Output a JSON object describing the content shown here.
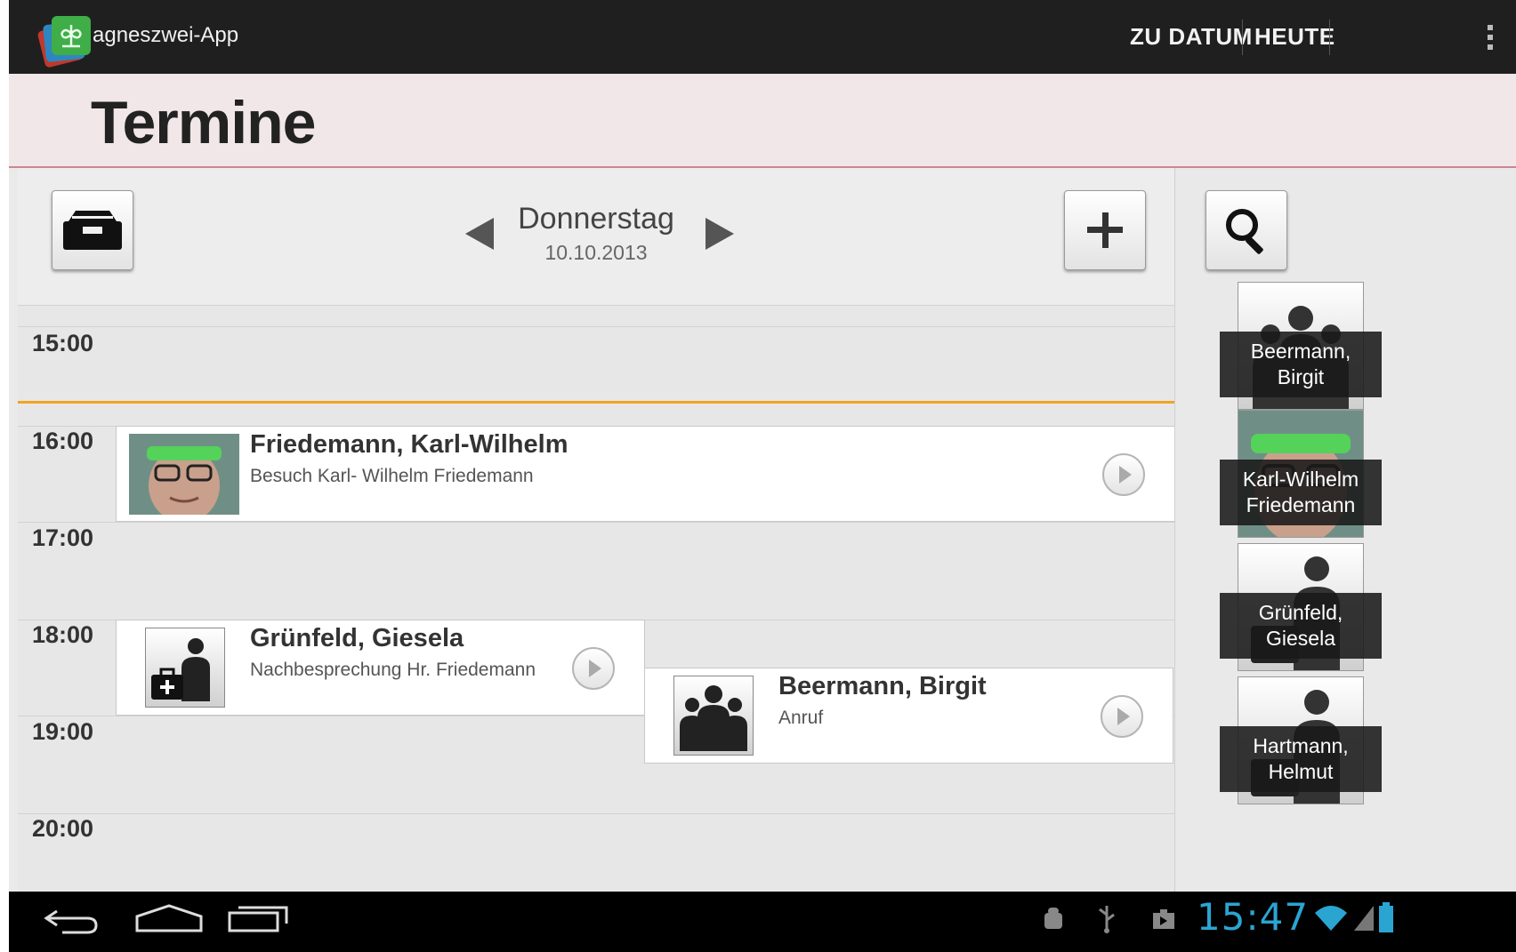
{
  "app": {
    "title": "agneszwei-App"
  },
  "actionbar": {
    "to_date": "ZU DATUM",
    "today": "HEUTE"
  },
  "page": {
    "title": "Termine"
  },
  "day_nav": {
    "day": "Donnerstag",
    "date": "10.10.2013"
  },
  "timeline": {
    "hours": [
      "15:00",
      "16:00",
      "17:00",
      "18:00",
      "19:00",
      "20:00"
    ],
    "appointments": [
      {
        "name": "Friedemann, Karl-Wilhelm",
        "description": "Besuch Karl- Wilhelm Friedemann"
      },
      {
        "name": "Grünfeld, Giesela",
        "description": "Nachbesprechung Hr. Friedemann"
      },
      {
        "name": "Beermann, Birgit",
        "description": "Anruf"
      }
    ]
  },
  "contacts": [
    {
      "line1": "Beermann,",
      "line2": "Birgit"
    },
    {
      "line1": "Karl-Wilhelm",
      "line2": "Friedemann"
    },
    {
      "line1": "Grünfeld,",
      "line2": "Giesela"
    },
    {
      "line1": "Hartmann,",
      "line2": "Helmut"
    }
  ],
  "statusbar": {
    "time": "15:47"
  },
  "colors": {
    "actionbar": "#1f1f1f",
    "header": "#f2e7e8",
    "now_line": "#f1a422",
    "clock": "#2aa5d2"
  },
  "icons": [
    "app-logo-icon",
    "overflow-menu-icon",
    "inbox-icon",
    "add-icon",
    "search-icon",
    "play-icon",
    "back-icon",
    "home-icon",
    "recent-apps-icon",
    "android-debug-icon",
    "usb-icon",
    "download-icon",
    "wifi-icon",
    "signal-icon",
    "battery-icon"
  ]
}
